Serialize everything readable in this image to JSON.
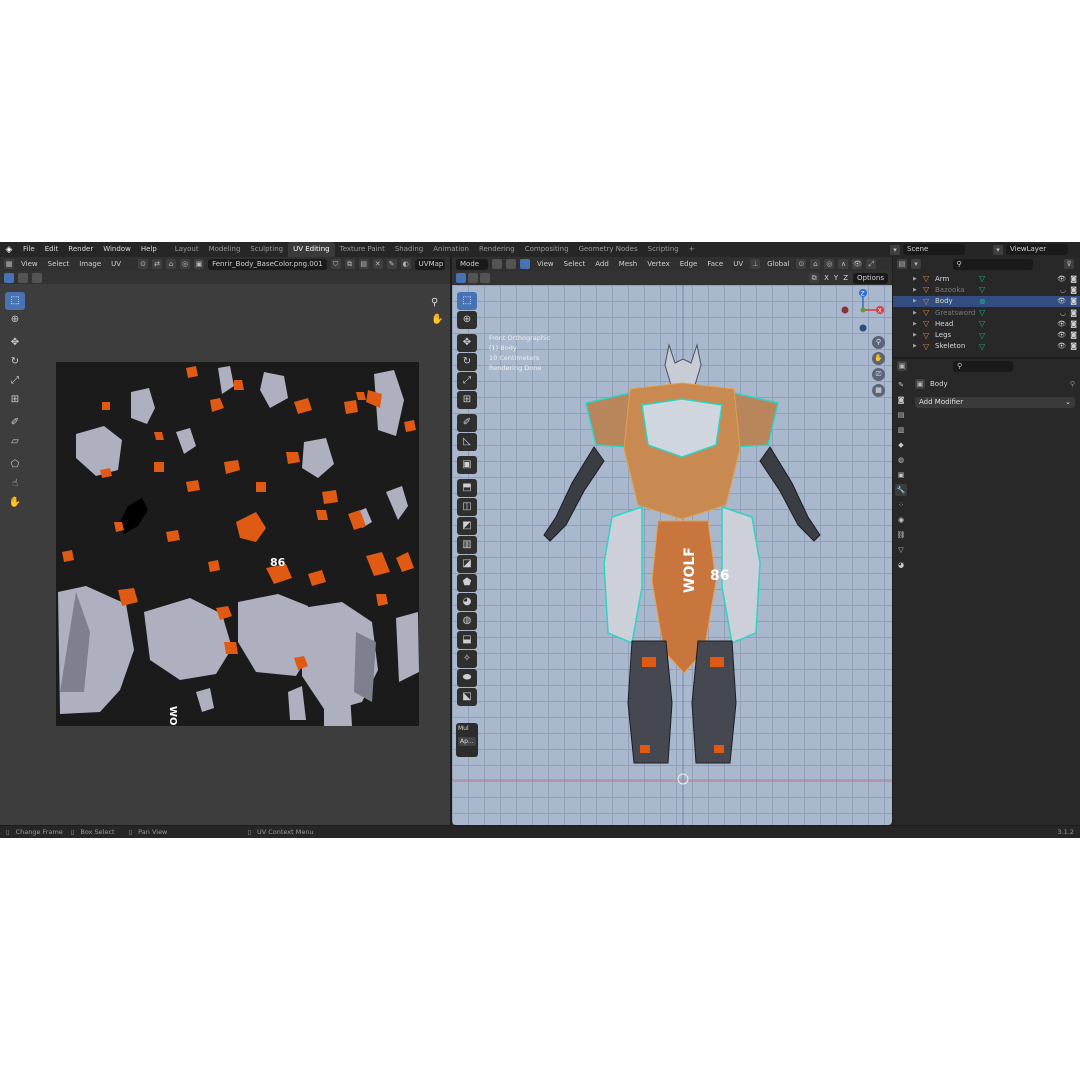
{
  "topbar": {
    "menus": [
      "File",
      "Edit",
      "Render",
      "Window",
      "Help"
    ],
    "workspaces": [
      "Layout",
      "Modeling",
      "Sculpting",
      "UV Editing",
      "Texture Paint",
      "Shading",
      "Animation",
      "Rendering",
      "Compositing",
      "Geometry Nodes",
      "Scripting"
    ],
    "active_workspace": "UV Editing",
    "add_tab": "+",
    "scene": "Scene",
    "view_layer": "ViewLayer"
  },
  "uv_editor": {
    "header_menus": [
      "View",
      "Select",
      "Image",
      "UV"
    ],
    "image_name": "Fenrir_Body_BaseColor.png.001",
    "uv_map": "UVMap",
    "texture_labels": {
      "num": "86",
      "wolf": "WOLF"
    }
  },
  "viewport": {
    "mode": "Mode",
    "header_menus": [
      "View",
      "Select",
      "Add",
      "Mesh",
      "Vertex",
      "Edge",
      "Face",
      "UV"
    ],
    "orientation": "Global",
    "axes": [
      "X",
      "Y",
      "Z"
    ],
    "options": "Options",
    "info_lines": [
      "Front Orthographic",
      "(1) Body",
      "10 Centimeters",
      "Rendering Done"
    ],
    "gizmo_axes": {
      "z": "Z",
      "x": "X"
    },
    "panel_label": "Mul",
    "panel_button": "Ap...",
    "model_labels": {
      "num": "86",
      "wolf": "WOLF"
    }
  },
  "outliner": {
    "items": [
      {
        "name": "Arm",
        "enabled": true,
        "selected": false
      },
      {
        "name": "Bazooka",
        "enabled": false,
        "selected": false
      },
      {
        "name": "Body",
        "enabled": true,
        "selected": true
      },
      {
        "name": "Greatsword",
        "enabled": false,
        "selected": false
      },
      {
        "name": "Head",
        "enabled": true,
        "selected": false
      },
      {
        "name": "Legs",
        "enabled": true,
        "selected": false
      },
      {
        "name": "Skeleton",
        "enabled": true,
        "selected": false
      }
    ]
  },
  "properties": {
    "object_name": "Body",
    "add_modifier": "Add Modifier"
  },
  "statusbar": {
    "items": [
      "Change Frame",
      "Box Select",
      "Pan View",
      "UV Context Menu"
    ],
    "version": "3.1.2"
  },
  "colors": {
    "accent": "#4772b3",
    "object_orange": "#e08a3c",
    "modifier_teal": "#18b090",
    "viewport_bg": "#a9b8cc",
    "uv_orange": "#e05a14",
    "uv_gray": "#aeb0c0"
  }
}
